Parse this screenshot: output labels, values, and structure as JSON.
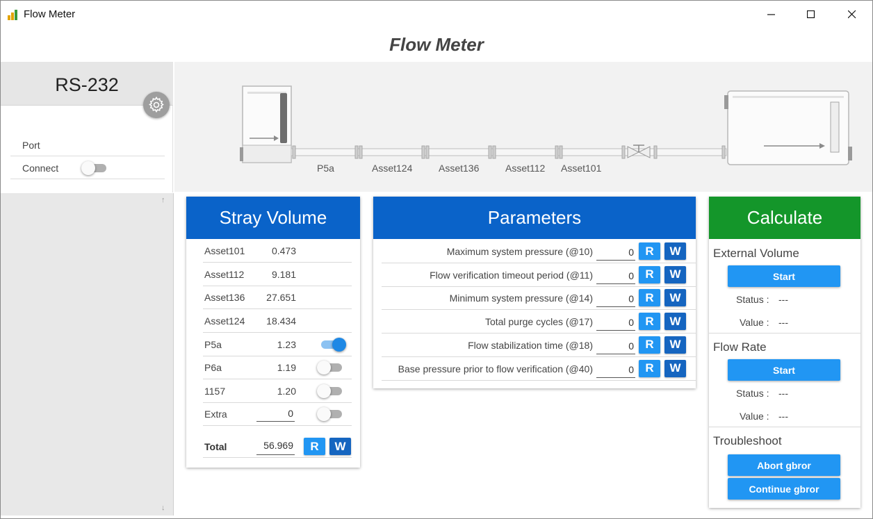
{
  "window": {
    "title": "Flow Meter",
    "minimize_icon": "minimize-icon",
    "maximize_icon": "maximize-icon",
    "close_icon": "close-icon"
  },
  "page_title": "Flow Meter",
  "connection": {
    "title": "RS-232",
    "settings_icon": "gear-icon",
    "port_label": "Port",
    "connect_label": "Connect",
    "connected": false
  },
  "diagram": {
    "pipe_labels": [
      "P5a",
      "Asset124",
      "Asset136",
      "Asset112",
      "Asset101"
    ]
  },
  "stray_volume": {
    "title": "Stray Volume",
    "header_color": "#0a63c9",
    "rows": [
      {
        "name": "Asset101",
        "value": "0.473"
      },
      {
        "name": "Asset112",
        "value": "9.181"
      },
      {
        "name": "Asset136",
        "value": "27.651"
      },
      {
        "name": "Asset124",
        "value": "18.434"
      },
      {
        "name": "P5a",
        "value": "1.23",
        "enabled": true
      },
      {
        "name": "P6a",
        "value": "1.19",
        "enabled": false
      },
      {
        "name": "1157",
        "value": "1.20",
        "enabled": false
      },
      {
        "name": "Extra",
        "value": "0",
        "enabled": false
      }
    ],
    "total_label": "Total",
    "total_value": "56.969",
    "read_label": "R",
    "write_label": "W"
  },
  "parameters": {
    "title": "Parameters",
    "header_color": "#0a63c9",
    "rows": [
      {
        "label": "Maximum system pressure (@10)",
        "value": "0"
      },
      {
        "label": "Flow verification timeout period (@11)",
        "value": "0"
      },
      {
        "label": "Minimum system pressure (@14)",
        "value": "0"
      },
      {
        "label": "Total purge cycles (@17)",
        "value": "0"
      },
      {
        "label": "Flow stabilization time (@18)",
        "value": "0"
      },
      {
        "label": "Base pressure prior to flow verification (@40)",
        "value": "0"
      }
    ],
    "read_label": "R",
    "write_label": "W"
  },
  "calculate": {
    "title": "Calculate",
    "header_color": "#14962a",
    "external_volume": {
      "title": "External Volume",
      "button": "Start",
      "status_label": "Status :",
      "status_value": "---",
      "value_label": "Value :",
      "value_value": "---"
    },
    "flow_rate": {
      "title": "Flow Rate",
      "button": "Start",
      "status_label": "Status :",
      "status_value": "---",
      "value_label": "Value :",
      "value_value": "---"
    },
    "troubleshoot": {
      "title": "Troubleshoot",
      "abort_button": "Abort gbror",
      "continue_button": "Continue gbror"
    }
  }
}
